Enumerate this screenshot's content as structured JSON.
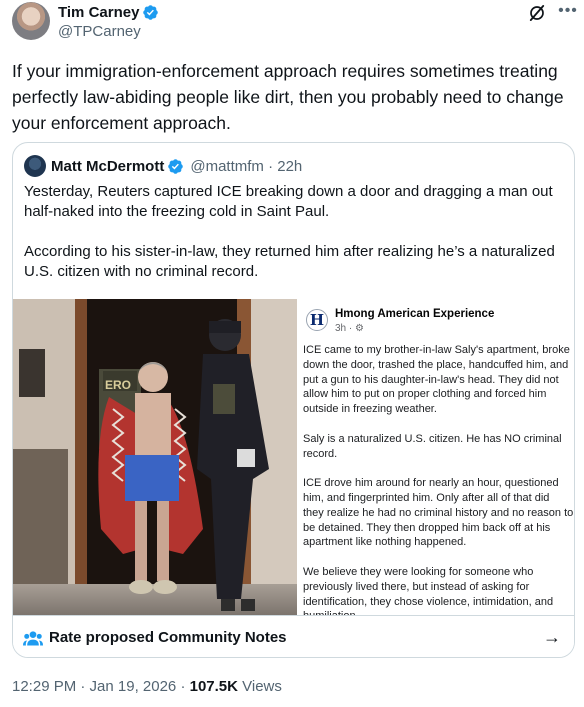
{
  "author": {
    "name": "Tim Carney",
    "handle": "@TPCarney"
  },
  "tweet": {
    "text": "If your immigration-enforcement approach requires sometimes treating perfectly law-abiding people like dirt, then you probably need to change your enforcement approach."
  },
  "quoted": {
    "name": "Matt McDermott",
    "handle": "@mattmfm · 22h",
    "paragraphs": [
      "Yesterday, Reuters captured ICE breaking down a door and dragging a man out half-naked into the freezing cold in Saint Paul.",
      "According to his sister-in-law, they returned him after realizing he’s a naturalized U.S. citizen with no criminal record."
    ],
    "media": {
      "vest_text": "ERO",
      "fb_logo_letter": "H",
      "fb_page_name": "Hmong American Experience",
      "fb_meta": "3h · ⚙",
      "fb_paragraphs": [
        "ICE came to my brother-in-law Saly's apartment, broke\ndown the door, trashed the place, handcuffed him, and\nput a gun to his daughter-in-law's head. They did not\nallow him to put on proper clothing and forced him\noutside in freezing weather.",
        "Saly is a naturalized U.S. citizen. He has NO criminal\nrecord.",
        "ICE drove him around for nearly an hour, questioned\nhim, and fingerprinted him. Only after all of that did\nthey realize he had no criminal history and no reason to\nbe detained. They then dropped him back off at his\napartment like nothing happened.",
        "We believe they were looking for someone who\npreviously lived there, but instead of asking for\nidentification, they chose violence, intimidation, and\nhumiliation."
      ]
    }
  },
  "community_notes": {
    "label": "Rate proposed Community Notes",
    "arrow": "→"
  },
  "footer": {
    "time_date": "12:29 PM · Jan 19, 2026 · ",
    "views_count": "107.5K",
    "views_label": " Views"
  },
  "colors": {
    "accent": "#1d9bf0",
    "text_primary": "#0f1419",
    "text_secondary": "#536471",
    "border": "#cfd9de"
  },
  "icons": {
    "verified": "verified-badge-icon",
    "grok": "grok-icon",
    "more": "more-options-icon",
    "notes": "community-notes-icon",
    "arrow": "arrow-right-icon"
  }
}
